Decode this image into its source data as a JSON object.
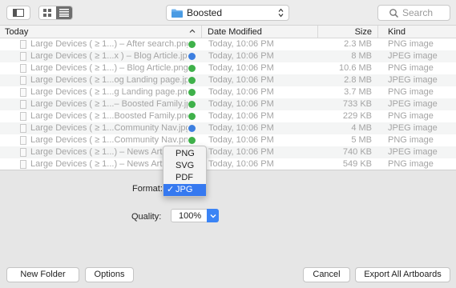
{
  "toolbar": {
    "location": "Boosted",
    "search_placeholder": "Search"
  },
  "header": {
    "name": "Today",
    "date_modified": "Date Modified",
    "size": "Size",
    "kind": "Kind"
  },
  "files": [
    {
      "name": "Large Devices ( ≥ 1...) – After search.png",
      "status": "ok",
      "date": "Today, 10:06 PM",
      "size": "2.3 MB",
      "kind": "PNG image"
    },
    {
      "name": "Large Devices ( ≥ 1...x ) – Blog Article.jpg",
      "status": "sync",
      "date": "Today, 10:06 PM",
      "size": "8 MB",
      "kind": "JPEG image"
    },
    {
      "name": "Large Devices ( ≥ 1...) – Blog Article.png",
      "status": "ok",
      "date": "Today, 10:06 PM",
      "size": "10.6 MB",
      "kind": "PNG image"
    },
    {
      "name": "Large Devices ( ≥ 1...og Landing page.jpg",
      "status": "ok",
      "date": "Today, 10:06 PM",
      "size": "2.8 MB",
      "kind": "JPEG image"
    },
    {
      "name": "Large Devices ( ≥ 1...g Landing page.png",
      "status": "ok",
      "date": "Today, 10:06 PM",
      "size": "3.7 MB",
      "kind": "PNG image"
    },
    {
      "name": "Large Devices ( ≥ 1...– Boosted Family.jpg",
      "status": "ok",
      "date": "Today, 10:06 PM",
      "size": "733 KB",
      "kind": "JPEG image"
    },
    {
      "name": "Large Devices ( ≥ 1...Boosted Family.png",
      "status": "ok",
      "date": "Today, 10:06 PM",
      "size": "229 KB",
      "kind": "PNG image"
    },
    {
      "name": "Large Devices ( ≥ 1...Community Nav.jpg",
      "status": "sync",
      "date": "Today, 10:06 PM",
      "size": "4 MB",
      "kind": "JPEG image"
    },
    {
      "name": "Large Devices ( ≥ 1...Community Nav.png",
      "status": "ok",
      "date": "Today, 10:06 PM",
      "size": "5 MB",
      "kind": "PNG image"
    },
    {
      "name": "Large Devices ( ≥ 1...) – News Article",
      "status": "ok",
      "date": "Today, 10:06 PM",
      "size": "740 KB",
      "kind": "JPEG image"
    },
    {
      "name": "Large Devices ( ≥ 1...) – News Article",
      "status": "ok",
      "date": "Today, 10:06 PM",
      "size": "549 KB",
      "kind": "PNG image"
    }
  ],
  "format": {
    "label": "Format:",
    "options": [
      "PNG",
      "SVG",
      "PDF",
      "JPG"
    ],
    "selected": "JPG"
  },
  "quality": {
    "label": "Quality:",
    "value": "100%"
  },
  "buttons": {
    "new_folder": "New Folder",
    "options": "Options",
    "cancel": "Cancel",
    "export": "Export All Artboards"
  },
  "colors": {
    "accent": "#3679f0",
    "status_ok": "#3fb14a",
    "status_sync": "#3d7fe0"
  }
}
